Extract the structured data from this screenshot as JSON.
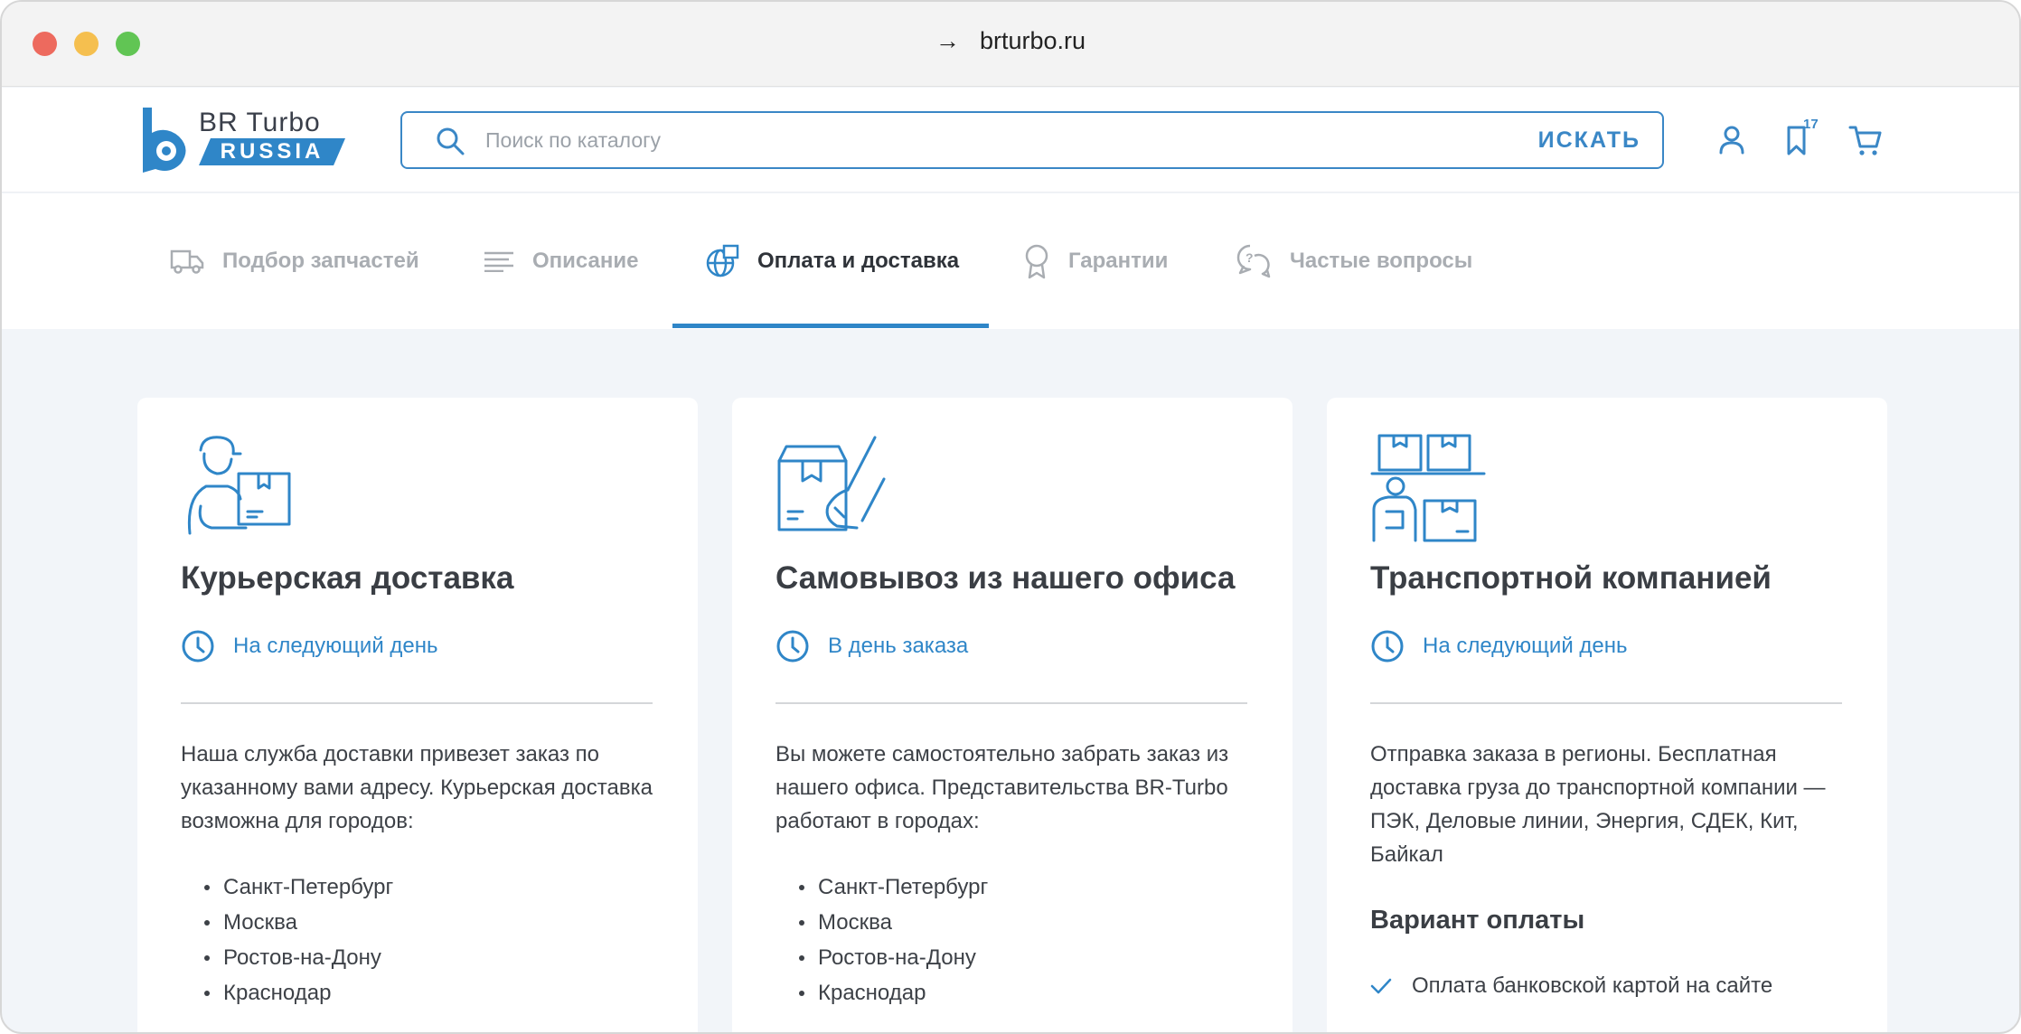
{
  "browser": {
    "url": "brturbo.ru",
    "arrow": "→"
  },
  "header": {
    "logo_line1": "BR Turbo",
    "logo_line2": "RUSSIA",
    "search_placeholder": "Поиск по каталогу",
    "search_button": "ИСКАТЬ",
    "favorites_count": "17",
    "icons": [
      "search-icon",
      "user-icon",
      "bookmark-icon",
      "cart-icon"
    ]
  },
  "tabs": [
    {
      "label": "Подбор запчастей",
      "icon": "truck-icon",
      "active": false
    },
    {
      "label": "Описание",
      "icon": "lines-icon",
      "active": false
    },
    {
      "label": "Оплата и доставка",
      "icon": "globe-box-icon",
      "active": true
    },
    {
      "label": "Гарантии",
      "icon": "award-icon",
      "active": false
    },
    {
      "label": "Частые вопросы",
      "icon": "chat-question-icon",
      "active": false
    }
  ],
  "cards": [
    {
      "icon": "courier-icon",
      "title": "Курьерская доставка",
      "time": "На следующий день",
      "description": "Наша служба доставки привезет заказ по указанному вами адресу. Курьерская доставка возможна для городов:",
      "cities": [
        "Санкт-Петербург",
        "Москва",
        "Ростов-на-Дону",
        "Краснодар"
      ]
    },
    {
      "icon": "pickup-box-icon",
      "title": "Самовывоз из нашего офиса",
      "time": "В день заказа",
      "description": "Вы можете самостоятельно забрать заказ из нашего офиса. Представительства BR-Turbo работают в городах:",
      "cities": [
        "Санкт-Петербург",
        "Москва",
        "Ростов-на-Дону",
        "Краснодар"
      ]
    },
    {
      "icon": "warehouse-icon",
      "title": "Транспортной компанией",
      "time": "На следующий день",
      "description": "Отправка заказа в регионы. Бесплатная доставка груза до транспортной компании — ПЭК, Деловые линии, Энергия, СДЕК, Кит, Байкал",
      "payment_title": "Вариант оплаты",
      "payment_options": [
        "Оплата банковской картой на сайте"
      ]
    }
  ],
  "colors": {
    "accent": "#2f86c8",
    "background": "#f2f5f9",
    "text_dark": "#3a3e44",
    "tab_inactive": "#a9adb2"
  }
}
